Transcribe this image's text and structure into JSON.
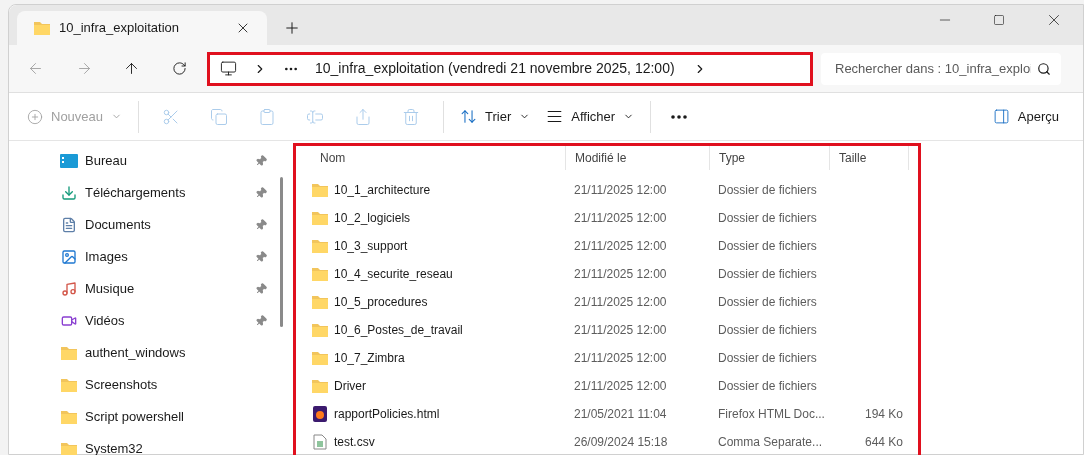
{
  "tab": {
    "title": "10_infra_exploitation",
    "selected": true
  },
  "address": {
    "path": "10_infra_exploitation (vendredi 21 novembre 2025, 12:00)",
    "highlighted": true
  },
  "search": {
    "placeholder": "Rechercher dans : 10_infra_exploi"
  },
  "toolbar": [
    {
      "kind": "new",
      "label": "Nouveau",
      "disabled": true
    },
    {
      "kind": "cut",
      "disabled": true
    },
    {
      "kind": "copy",
      "disabled": true
    },
    {
      "kind": "paste",
      "disabled": true
    },
    {
      "kind": "rename",
      "disabled": true
    },
    {
      "kind": "share",
      "disabled": true
    },
    {
      "kind": "delete",
      "disabled": true
    },
    {
      "kind": "sort",
      "label": "Trier",
      "disabled": false
    },
    {
      "kind": "view",
      "label": "Afficher",
      "disabled": false
    },
    {
      "kind": "more",
      "disabled": false
    }
  ],
  "preview": {
    "label": "Aperçu"
  },
  "sidebar": {
    "items": [
      {
        "label": "Bureau",
        "kind": "desktop",
        "pinned": true
      },
      {
        "label": "Téléchargements",
        "kind": "download",
        "pinned": true
      },
      {
        "label": "Documents",
        "kind": "documents",
        "pinned": true
      },
      {
        "label": "Images",
        "kind": "images",
        "pinned": true
      },
      {
        "label": "Musique",
        "kind": "music",
        "pinned": true
      },
      {
        "label": "Vidéos",
        "kind": "videos",
        "pinned": true
      },
      {
        "label": "authent_windows",
        "kind": "folder",
        "pinned": false
      },
      {
        "label": "Screenshots",
        "kind": "folder",
        "pinned": false
      },
      {
        "label": "Script powershell",
        "kind": "folder",
        "pinned": false
      },
      {
        "label": "System32",
        "kind": "folder",
        "pinned": false
      }
    ]
  },
  "table": {
    "highlighted": true,
    "columns": [
      "Nom",
      "Modifié le",
      "Type",
      "Taille"
    ],
    "rows": [
      {
        "kind": "folder",
        "name": "10_1_architecture",
        "modified": "21/11/2025 12:00",
        "type": "Dossier de fichiers"
      },
      {
        "kind": "folder",
        "name": "10_2_logiciels",
        "modified": "21/11/2025 12:00",
        "type": "Dossier de fichiers"
      },
      {
        "kind": "folder",
        "name": "10_3_support",
        "modified": "21/11/2025 12:00",
        "type": "Dossier de fichiers"
      },
      {
        "kind": "folder",
        "name": "10_4_securite_reseau",
        "modified": "21/11/2025 12:00",
        "type": "Dossier de fichiers"
      },
      {
        "kind": "folder",
        "name": "10_5_procedures",
        "modified": "21/11/2025 12:00",
        "type": "Dossier de fichiers"
      },
      {
        "kind": "folder",
        "name": "10_6_Postes_de_travail",
        "modified": "21/11/2025 12:00",
        "type": "Dossier de fichiers"
      },
      {
        "kind": "folder",
        "name": "10_7_Zimbra",
        "modified": "21/11/2025 12:00",
        "type": "Dossier de fichiers"
      },
      {
        "kind": "folder",
        "name": "Driver",
        "modified": "21/11/2025 12:00",
        "type": "Dossier de fichiers"
      },
      {
        "kind": "html",
        "name": "rapportPolicies.html",
        "modified": "21/05/2021 11:04",
        "type": "Firefox HTML Doc...",
        "size": "194 Ko"
      },
      {
        "kind": "csv",
        "name": "test.csv",
        "modified": "26/09/2024 15:18",
        "type": "Comma Separate...",
        "size": "644 Ko"
      }
    ]
  }
}
